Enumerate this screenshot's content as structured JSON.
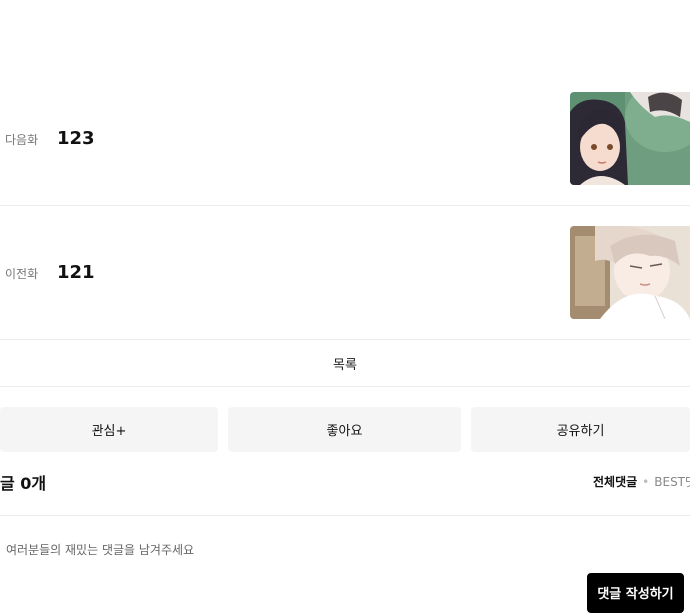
{
  "next_episode": {
    "label": "다음화",
    "number": "123"
  },
  "prev_episode": {
    "label": "이전화",
    "number": "121"
  },
  "list_button": "목록",
  "actions": {
    "interest": "관심+",
    "like": "좋아요",
    "share": "공유하기"
  },
  "comments": {
    "count_text": "글 0개",
    "sort_all": "전체댓글",
    "sort_separator": "•",
    "sort_best": "BEST댓",
    "placeholder": "여러분들의 재밌는 댓글을 남겨주세요",
    "write_button": "댓글 작성하기"
  }
}
